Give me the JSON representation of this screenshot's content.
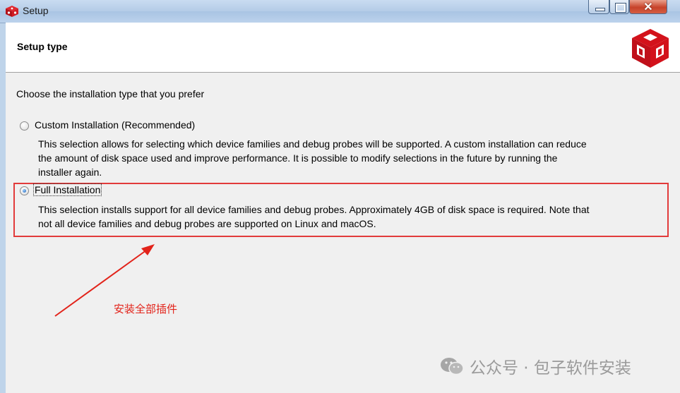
{
  "window": {
    "title": "Setup",
    "icon": "app-cube-icon",
    "controls": {
      "minimize": "minimize-icon",
      "maximize": "maximize-icon",
      "close": "✕"
    }
  },
  "header": {
    "title": "Setup type",
    "logo": "red-cube-logo"
  },
  "content": {
    "prompt": "Choose the installation type that you prefer",
    "options": [
      {
        "label": "Custom Installation (Recommended)",
        "selected": false,
        "description_lines": [
          "This selection allows for selecting which device families and debug probes will be supported.  A custom installation can reduce",
          "the amount of disk space used and improve performance.  It is possible to modify selections in the future by running the",
          "installer again."
        ]
      },
      {
        "label": "Full Installation",
        "selected": true,
        "description_lines": [
          "This selection installs support for all device families and debug probes.  Approximately 4GB of disk space is required.  Note that",
          "not all device families and debug probes are supported on Linux and macOS."
        ]
      }
    ]
  },
  "annotation": {
    "text": "安装全部插件",
    "color": "#e2231a"
  },
  "watermark": {
    "text": "公众号 · 包子软件安装",
    "icon": "wechat-icon"
  },
  "colors": {
    "highlight": "#e23b3b",
    "logo": "#d3121b"
  }
}
